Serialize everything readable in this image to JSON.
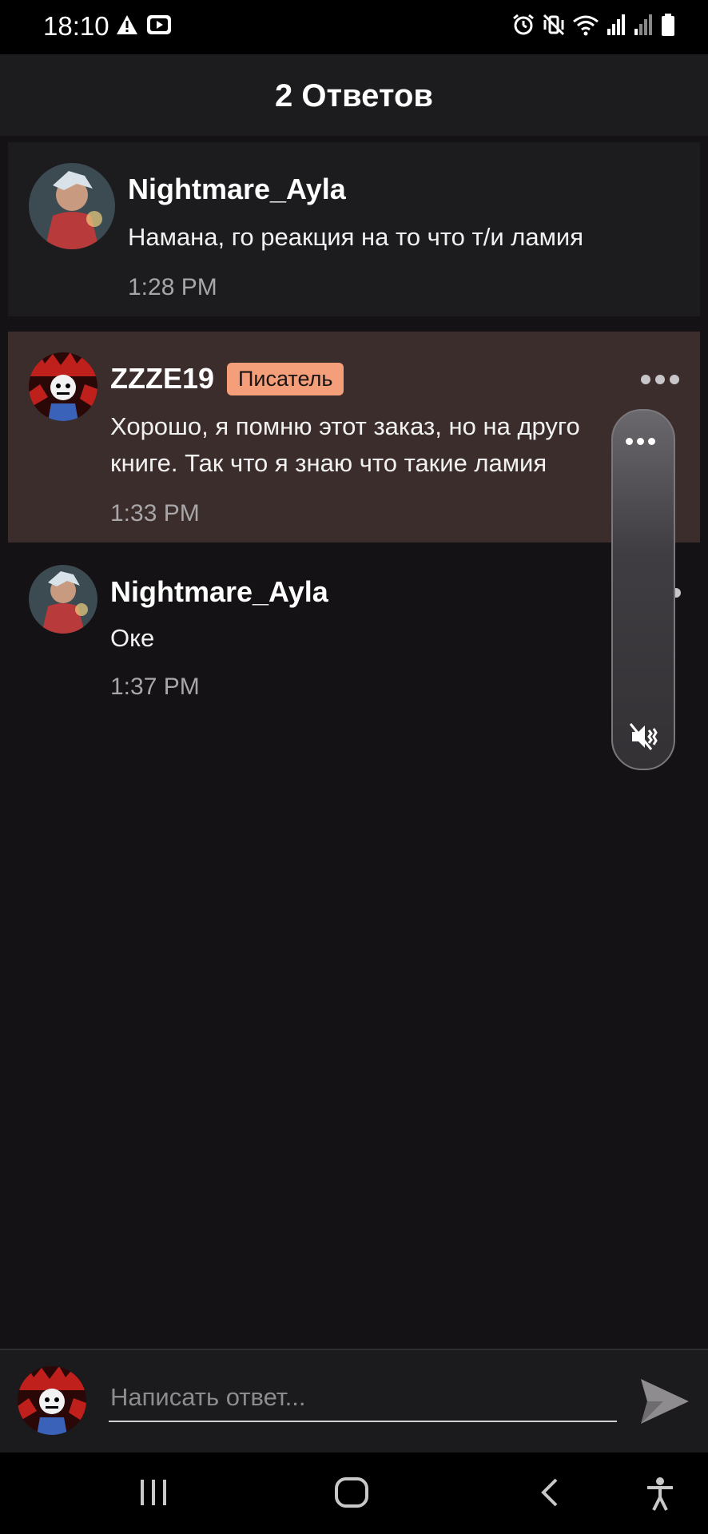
{
  "status_bar": {
    "time": "18:10",
    "left_icons": [
      "warning-icon",
      "youtube-icon"
    ],
    "right_icons": [
      "alarm-icon",
      "vibrate-icon",
      "wifi-icon",
      "signal-icon",
      "signal-icon",
      "battery-icon"
    ]
  },
  "header": {
    "title": "2 Ответов"
  },
  "comments": [
    {
      "author": "Nightmare_Ayla",
      "text": "Намана, го реакция на то что т/и ламия",
      "time": "1:28 PM"
    },
    {
      "author": "ZZZE19",
      "badge": "Писатель",
      "text_line1": "Хорошо, я помню этот заказ, но на друго",
      "text_line2": "книге. Так что я знаю что такие ламия",
      "time": "1:33 PM"
    },
    {
      "author": "Nightmare_Ayla",
      "text": "Оке",
      "time": "1:37 PM"
    }
  ],
  "composer": {
    "placeholder": "Написать ответ..."
  },
  "colors": {
    "background": "#141214",
    "highlight": "#3a2d2b",
    "badge": "#f59f7a"
  }
}
